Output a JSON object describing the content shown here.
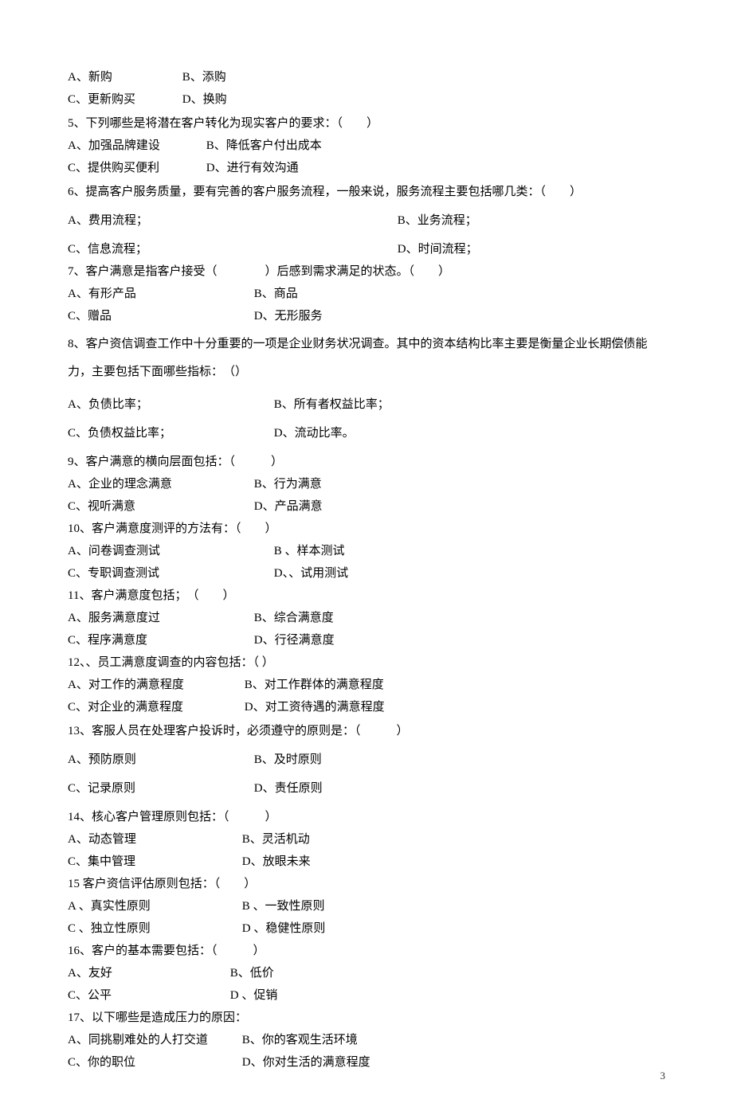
{
  "q4": {
    "A": "A、新购",
    "B": "B、添购",
    "C": "C、更新购买",
    "D": "D、换购"
  },
  "q5": {
    "stem": "5、下列哪些是将潜在客户转化为现实客户的要求：（　　）",
    "A": "A、加强品牌建设",
    "B": "B、降低客户付出成本",
    "C": "C、提供购买便利",
    "D": "D、进行有效沟通"
  },
  "q6": {
    "stem": "6、提高客户服务质量，要有完善的客户服务流程，一般来说，服务流程主要包括哪几类：（　　）",
    "A": "A、费用流程；",
    "B": "B、业务流程；",
    "C": "C、信息流程；",
    "D": "D、时间流程；"
  },
  "q7": {
    "stem": "7、客户满意是指客户接受（　　　　）后感到需求满足的状态。（　　）",
    "A": "A、有形产品",
    "B": "B、商品",
    "C": "C、赠品",
    "D": "D、无形服务"
  },
  "q8": {
    "stem": "8、客户资信调查工作中十分重要的一项是企业财务状况调查。其中的资本结构比率主要是衡量企业长期偿债能力，主要包括下面哪些指标：　（）",
    "A": "A、负债比率；",
    "B": "B、所有者权益比率；",
    "C": "C、负债权益比率；",
    "D": "D、流动比率。"
  },
  "q9": {
    "stem": "9、客户满意的横向层面包括：（　　　）",
    "A": "A、企业的理念满意",
    "B": "B、行为满意",
    "C": "C、视听满意",
    "D": "D、产品满意"
  },
  "q10": {
    "stem": "10、客户满意度测评的方法有：（　　）",
    "A": "A、问卷调查测试",
    "B": "B 、样本测试",
    "C": "C、专职调查测试",
    "D": "D、、试用测试"
  },
  "q11": {
    "stem": "11、客户满意度包括；　（　　）",
    "A": "A、服务满意度过",
    "B": "B、综合满意度",
    "C": "C、程序满意度",
    "D": "D、行径满意度"
  },
  "q12": {
    "stem": "12、、员工满意度调查的内容包括：（  ）",
    "A": "A、对工作的满意程度",
    "B": "B、对工作群体的满意程度",
    "C": "C、对企业的满意程度",
    "D": "D、对工资待遇的满意程度"
  },
  "q13": {
    "stem": "13、客服人员在处理客户投诉时，必须遵守的原则是：（　　　）",
    "A": "A、预防原则",
    "B": "B、及时原则",
    "C": "C、记录原则",
    "D": "D、责任原则"
  },
  "q14": {
    "stem": "14、核心客户管理原则包括：（　　　）",
    "A": "A、动态管理",
    "B": "B、灵活机动",
    "C": "C、集中管理",
    "D": "D、放眼未来"
  },
  "q15": {
    "stem": "15 客户资信评估原则包括：（　　）",
    "A": "A 、真实性原则",
    "B": "B 、一致性原则",
    "C": "C 、独立性原则",
    "D": "D 、稳健性原则"
  },
  "q16": {
    "stem": "16、客户的基本需要包括：（　　　）",
    "A": "A、友好",
    "B": "B、低价",
    "C": "C、公平",
    "D": "D 、促销"
  },
  "q17": {
    "stem": "17、以下哪些是造成压力的原因：",
    "A": " A、同挑剔难处的人打交道",
    "B": "B、你的客观生活环境",
    "C": "C、你的职位",
    "D": "D、你对生活的满意程度"
  },
  "pageNumber": "3"
}
